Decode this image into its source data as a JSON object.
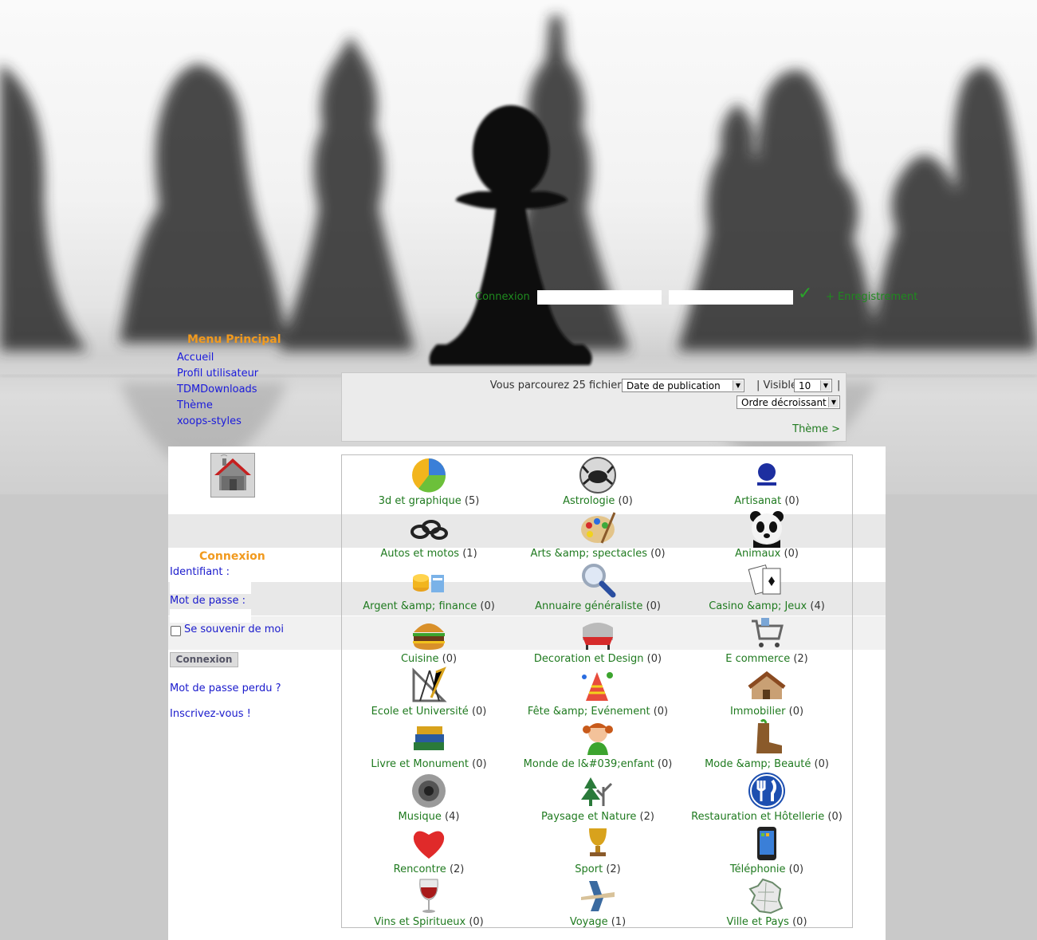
{
  "top_login": {
    "label": "Connexion",
    "register": "+ Enregistrement"
  },
  "main_menu": {
    "title": "Menu Principal",
    "items": [
      "Accueil",
      "Profil utilisateur",
      "TDMDownloads",
      "Thème",
      "xoops-styles"
    ]
  },
  "sort_bar": {
    "browse_text": "Vous parcourez 25 fichiers | Trier par",
    "sort_value": "Date de publication",
    "separator": "|",
    "visible_label": "| Visible",
    "visible_value": "10",
    "order_value": "Ordre décroissant",
    "theme_link": "Thème >"
  },
  "login_block": {
    "title": "Connexion",
    "username_label": "Identifiant :",
    "password_label": "Mot de passe :",
    "remember_label": "Se souvenir de moi",
    "submit_label": "Connexion",
    "lost_password": "Mot de passe perdu ?",
    "register": "Inscrivez-vous !"
  },
  "categories": [
    {
      "name": "3d et graphique",
      "count": "(5)",
      "icon": "pie-chart-icon"
    },
    {
      "name": "Astrologie",
      "count": "(0)",
      "icon": "crab-zodiac-icon"
    },
    {
      "name": "Artisanat",
      "count": "(0)",
      "icon": "artisan-logo-icon"
    },
    {
      "name": "Autos et motos",
      "count": "(1)",
      "icon": "chain-icon"
    },
    {
      "name": "Arts &amp; spectacles",
      "count": "(0)",
      "icon": "palette-icon"
    },
    {
      "name": "Animaux",
      "count": "(0)",
      "icon": "panda-icon"
    },
    {
      "name": "Argent &amp; finance",
      "count": "(0)",
      "icon": "coins-icon"
    },
    {
      "name": "Annuaire généraliste",
      "count": "(0)",
      "icon": "magnifier-icon"
    },
    {
      "name": "Casino &amp; Jeux",
      "count": "(4)",
      "icon": "playing-cards-icon"
    },
    {
      "name": "Cuisine",
      "count": "(0)",
      "icon": "burger-icon"
    },
    {
      "name": "Decoration et Design",
      "count": "(0)",
      "icon": "design-chair-icon"
    },
    {
      "name": "E commerce",
      "count": "(2)",
      "icon": "shopping-cart-icon"
    },
    {
      "name": "Ecole et Université",
      "count": "(0)",
      "icon": "drafting-tools-icon"
    },
    {
      "name": "Fête &amp; Evénement",
      "count": "(0)",
      "icon": "party-icon"
    },
    {
      "name": "Immobilier",
      "count": "(0)",
      "icon": "house-icon"
    },
    {
      "name": "Livre et Monument",
      "count": "(0)",
      "icon": "books-icon"
    },
    {
      "name": "Monde de l&#039;enfant",
      "count": "(0)",
      "icon": "child-icon"
    },
    {
      "name": "Mode &amp; Beauté",
      "count": "(0)",
      "icon": "boot-icon"
    },
    {
      "name": "Musique",
      "count": "(4)",
      "icon": "speaker-icon"
    },
    {
      "name": "Paysage et Nature",
      "count": "(2)",
      "icon": "trees-icon"
    },
    {
      "name": "Restauration et Hôtellerie",
      "count": "(0)",
      "icon": "fork-knife-icon"
    },
    {
      "name": "Rencontre",
      "count": "(2)",
      "icon": "heart-icon"
    },
    {
      "name": "Sport",
      "count": "(2)",
      "icon": "trophy-icon"
    },
    {
      "name": "Téléphonie",
      "count": "(0)",
      "icon": "smartphone-icon"
    },
    {
      "name": "Vins et Spiritueux",
      "count": "(0)",
      "icon": "wine-glass-icon"
    },
    {
      "name": "Voyage",
      "count": "(1)",
      "icon": "airplane-icon"
    },
    {
      "name": "Ville et Pays",
      "count": "(0)",
      "icon": "france-map-icon"
    }
  ],
  "colors": {
    "link_green": "#1f7a1f",
    "menu_orange": "#f19a1e",
    "link_blue": "#1a1adb"
  }
}
